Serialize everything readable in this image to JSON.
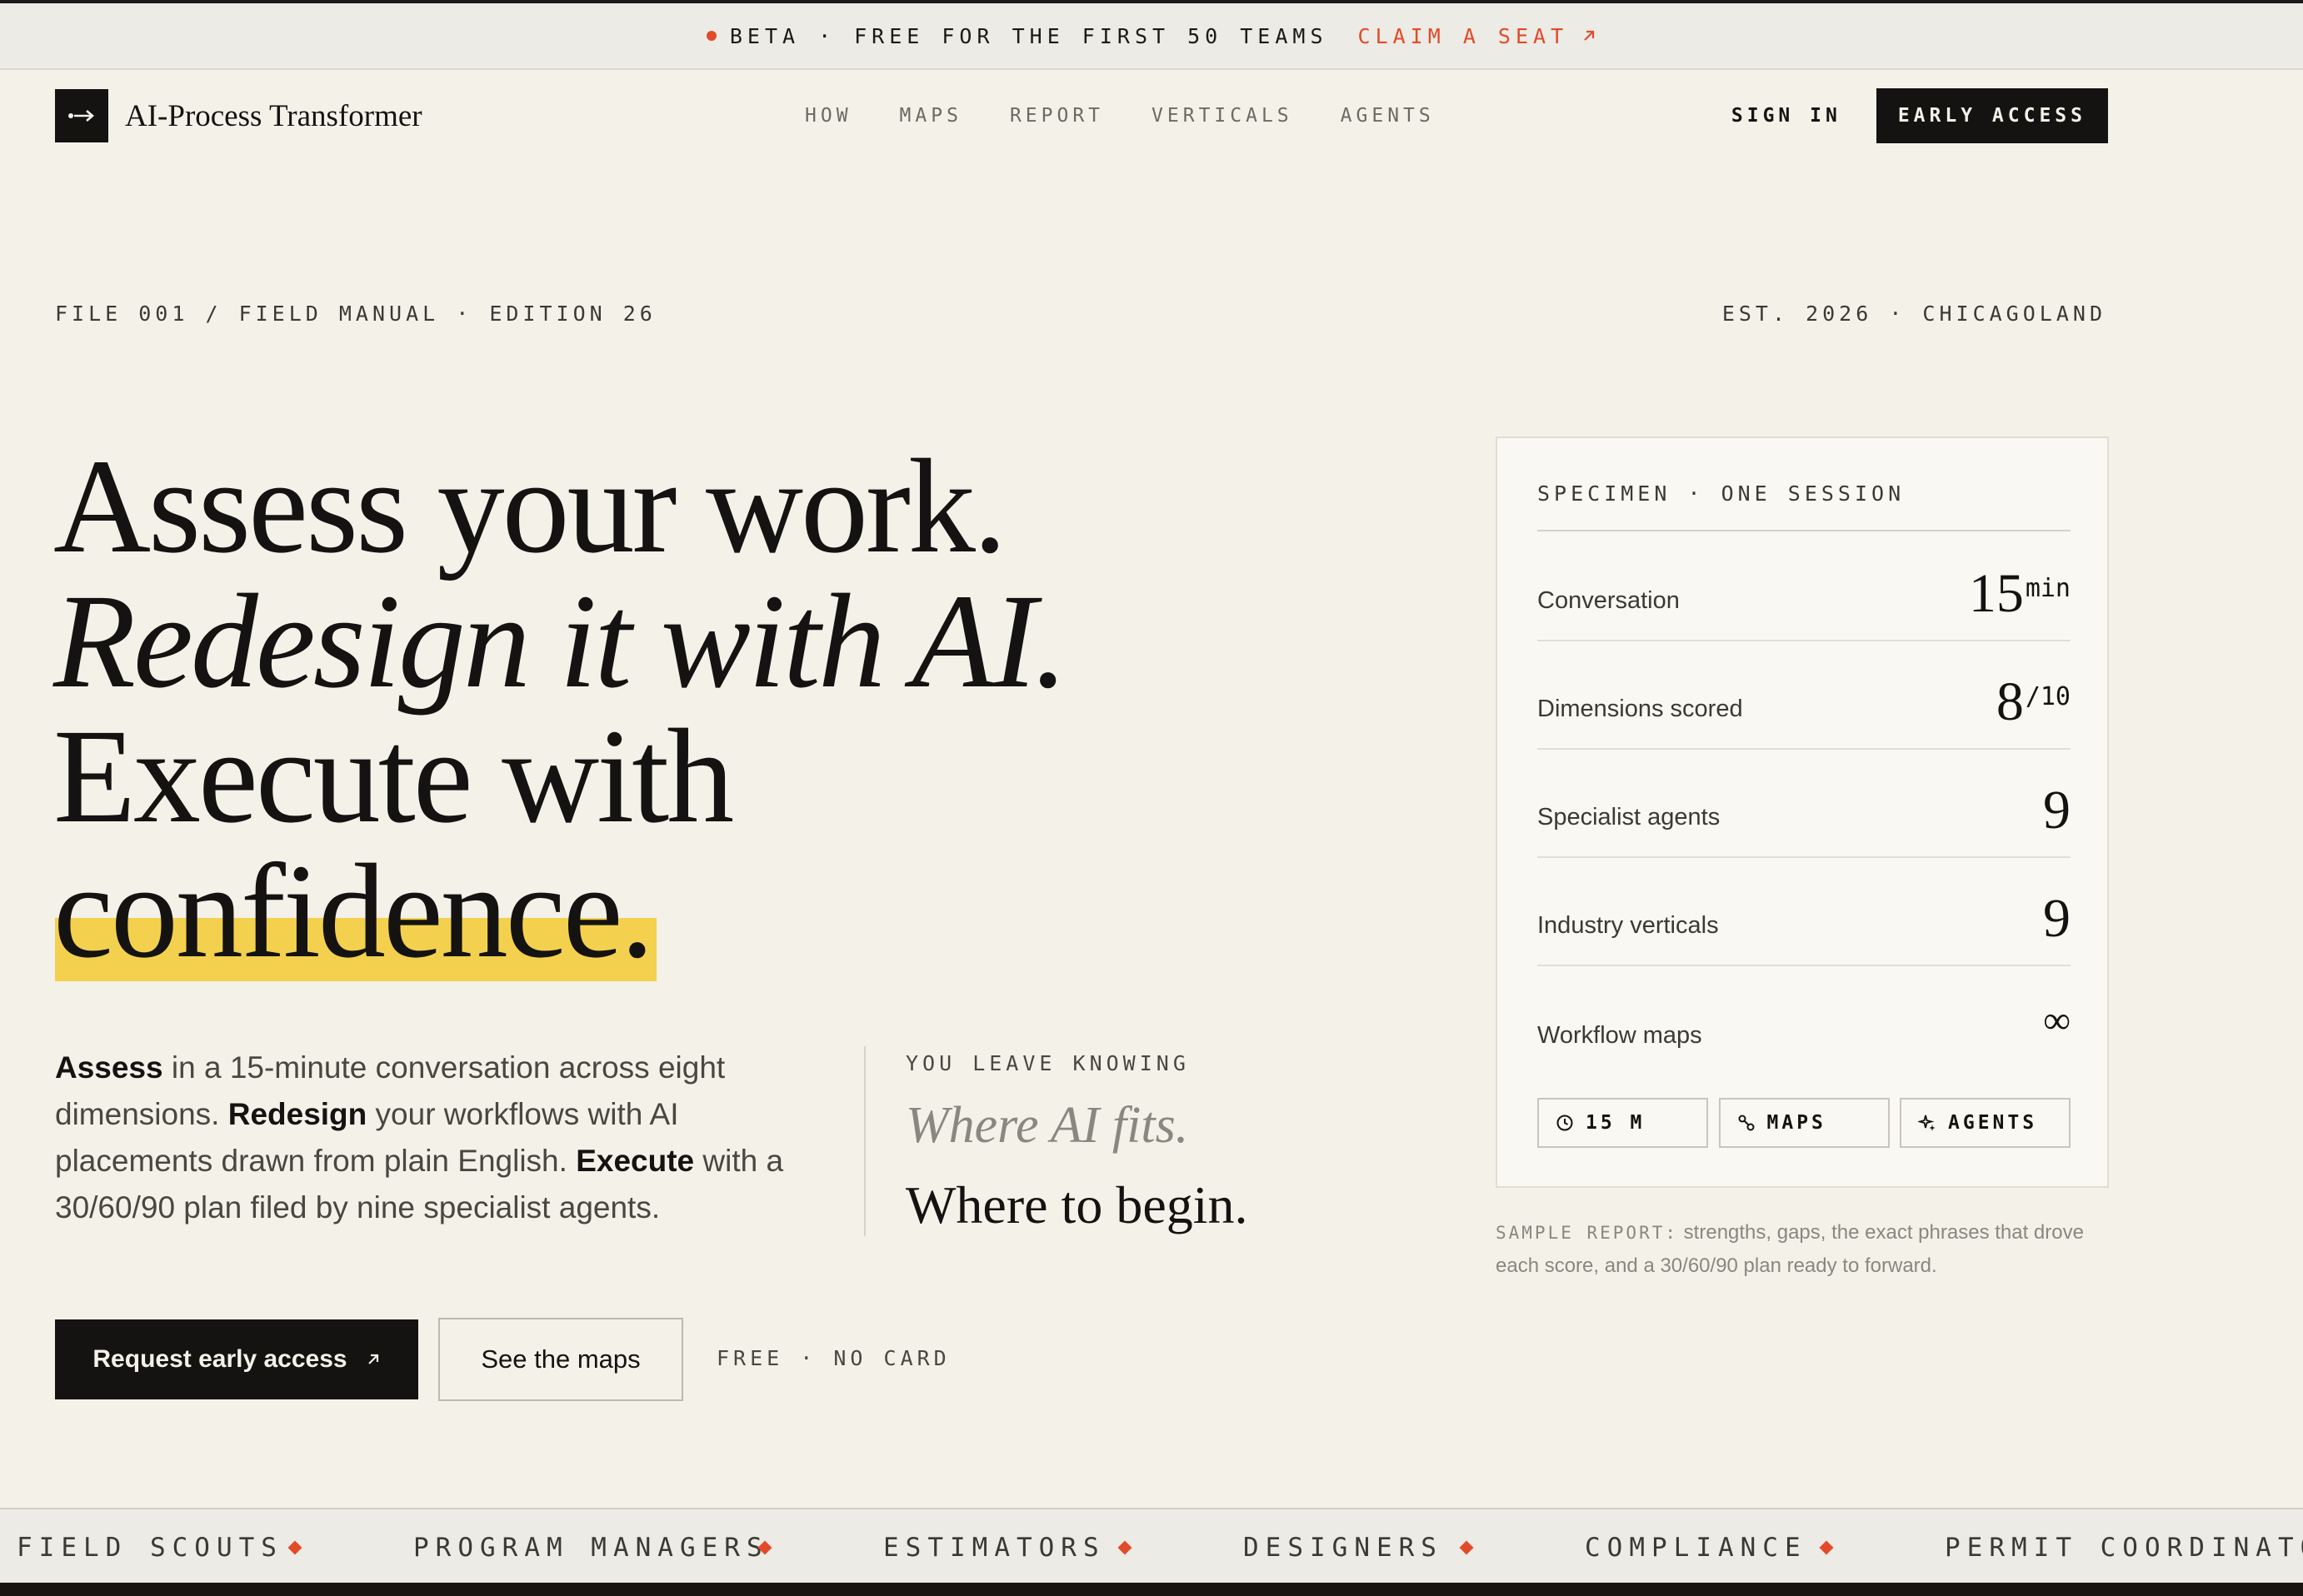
{
  "topbar": {
    "beta": "BETA",
    "separator": "·",
    "offer": "FREE FOR THE FIRST 50 TEAMS",
    "claim": "CLAIM A SEAT"
  },
  "nav": {
    "brand": "AI-Process Transformer",
    "links": [
      "HOW",
      "MAPS",
      "REPORT",
      "VERTICALS",
      "AGENTS"
    ],
    "sign_in": "SIGN IN",
    "early_access": "EARLY ACCESS"
  },
  "meta": {
    "left": "FILE 001 / FIELD MANUAL · EDITION 26",
    "right": "EST. 2026 · CHICAGOLAND"
  },
  "hero": {
    "line1": "Assess your work.",
    "line2": "Redesign it with AI.",
    "line3": "Execute with",
    "line4": "confidence."
  },
  "body": {
    "w1": "Assess",
    "t1": " in a 15-minute conversation across eight dimensions. ",
    "w2": "Redesign",
    "t2": " your workflows with AI placements drawn from plain English. ",
    "w3": "Execute",
    "t3": " with a 30/60/90 plan filed by nine specialist agents."
  },
  "knowing": {
    "label": "YOU LEAVE KNOWING",
    "where_ai": "Where AI fits.",
    "where_begin": "Where to begin."
  },
  "cta": {
    "primary": "Request early access",
    "secondary": "See the maps",
    "note": "FREE · NO CARD"
  },
  "card": {
    "label": "SPECIMEN · ONE SESSION",
    "rows": [
      {
        "label": "Conversation",
        "value": "15",
        "suffix": "min"
      },
      {
        "label": "Dimensions scored",
        "value": "8",
        "suffix": "/10"
      },
      {
        "label": "Specialist agents",
        "value": "9",
        "suffix": ""
      },
      {
        "label": "Industry verticals",
        "value": "9",
        "suffix": ""
      },
      {
        "label": "Workflow maps",
        "value": "∞",
        "suffix": ""
      }
    ],
    "chips": [
      "15 M",
      "MAPS",
      "AGENTS"
    ]
  },
  "sample": {
    "label": "SAMPLE REPORT:",
    "text": " strengths, gaps, the exact phrases that drove each score, and a 30/60/90 plan ready to forward."
  },
  "ticker": [
    "FIELD SCOUTS",
    "PROGRAM MANAGERS",
    "ESTIMATORS",
    "DESIGNERS",
    "COMPLIANCE",
    "PERMIT COORDINATORS"
  ],
  "colors": {
    "accent": "#e24b2a",
    "highlight": "#f3d14e",
    "ink": "#141311",
    "paper": "#f4f1e9"
  }
}
